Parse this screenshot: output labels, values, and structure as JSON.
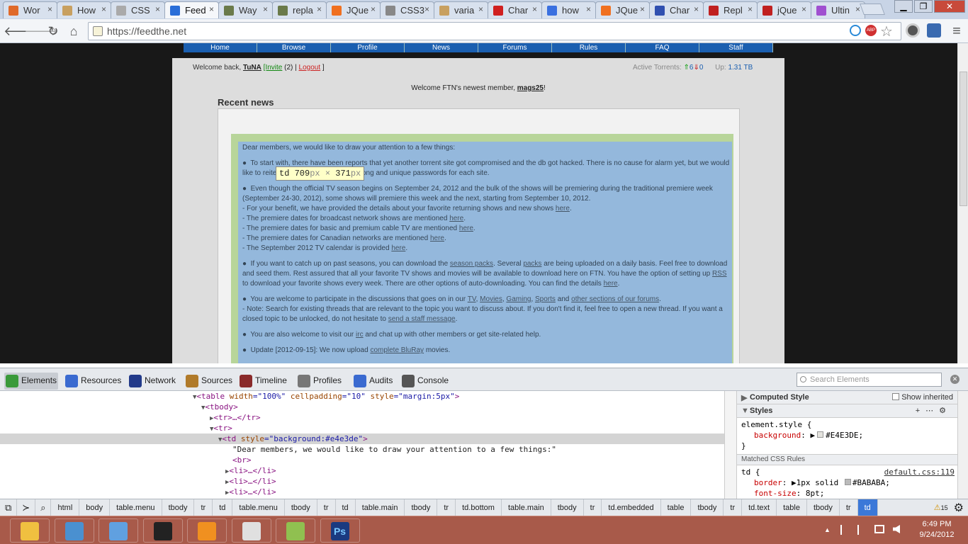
{
  "tabs": [
    {
      "label": "Wor",
      "color": "#e06a2a",
      "icon": "swirl-icon"
    },
    {
      "label": "How",
      "color": "#c8a060",
      "icon": "page-icon"
    },
    {
      "label": "CSS",
      "color": "#aaaaaa",
      "icon": "doc-icon"
    },
    {
      "label": "Feed",
      "color": "#2a6ed8",
      "icon": "feedthe-icon"
    },
    {
      "label": "Way",
      "color": "#6a7a4a",
      "icon": "zine-icon"
    },
    {
      "label": "repla",
      "color": "#6a7a4a",
      "icon": "zine-icon"
    },
    {
      "label": "JQue",
      "color": "#f07020",
      "icon": "blogger-icon"
    },
    {
      "label": "CSS3",
      "color": "#888888",
      "icon": "css3-icon"
    },
    {
      "label": "varia",
      "color": "#c8a060",
      "icon": "page-icon"
    },
    {
      "label": "Char",
      "color": "#d02020",
      "icon": "char-icon"
    },
    {
      "label": "how",
      "color": "#3a70e0",
      "icon": "google-icon"
    },
    {
      "label": "JQue",
      "color": "#f07020",
      "icon": "blogger-icon"
    },
    {
      "label": "Char",
      "color": "#3050b0",
      "icon": "m-icon"
    },
    {
      "label": "Repl",
      "color": "#c02020",
      "icon": "opera-icon"
    },
    {
      "label": "jQue",
      "color": "#c02020",
      "icon": "opera-icon"
    },
    {
      "label": "Ultin",
      "color": "#a050d0",
      "icon": "rainbow-icon"
    }
  ],
  "window": {
    "minimize": "▁",
    "restore": "❐",
    "close": "✕"
  },
  "toolbar": {
    "back": "🡐",
    "forward": "🡒",
    "reload": "↻",
    "home": "⌂",
    "url": "https://feedthe.net",
    "abp": "ABP",
    "star": "☆",
    "menu": "≡"
  },
  "site": {
    "nav": [
      "Home",
      "Browse",
      "Profile",
      "News",
      "Forums",
      "Rules",
      "FAQ",
      "Staff"
    ],
    "welcome_prefix": "Welcome back,",
    "username": "TuNA",
    "invite": "[Invite",
    "invite_count": "(2)",
    "sep": "|",
    "logout": "Logout",
    "close_bracket": "]",
    "active_label": "Active Torrents:",
    "seed_arrow": "⇑",
    "seed_count": "6",
    "leech_arrow": "⇓",
    "leech_count": "0",
    "up_label": "Up:",
    "up_value": "1.31 TB",
    "newest_prefix": "Welcome FTN's newest member,",
    "newest_member": "mags25",
    "newest_suffix": "!",
    "recent_news": "Recent news",
    "tooltip_tag": "td",
    "tooltip_w": "709",
    "tooltip_h": "371",
    "tooltip_px1": "px",
    "tooltip_x": " × ",
    "tooltip_px2": "px",
    "news_intro": "Dear members, we would like to draw your attention to a few things:",
    "p1": "To start with, there have been reports that yet another torrent site got compromised and the db got hacked. There is no cause for alarm yet, but we would like to reiterate that you should use strong and unique passwords for each site.",
    "p2a": "Even though the official TV season begins on September 24, 2012 and the bulk of the shows will be premiering during the traditional premiere week (September 24-30, 2012), some shows will premiere this week and the next, starting from September 10, 2012.",
    "p2b": "- For your benefit, we have provided the details about your favorite returning shows and new shows",
    "p2c": "- The premiere dates for broadcast network shows are mentioned",
    "p2d": "- The premiere dates for basic and premium cable TV are mentioned",
    "p2e": "- The premiere dates for Canadian networks are mentioned",
    "p2f": "- The September 2012 TV calendar is provided",
    "here": "here",
    "dot": ".",
    "p3a": "If you want to catch up on past seasons, you can download the",
    "season_packs": "season packs",
    "p3b": ". Several",
    "packs": "packs",
    "p3c": "are being uploaded on a daily basis. Feel free to download and seed them. Rest assured that all your favorite TV shows and movies will be available to download here on FTN. You have the option of setting up",
    "rss": "RSS",
    "p3d": "to download your favorite shows every week. There are other options of auto-downloading. You can find the details",
    "p4a": "You are welcome to participate in the discussions that goes on in our",
    "tv": "TV",
    "movies": "Movies",
    "gaming": "Gaming",
    "sports": "Sports",
    "and_text": "and",
    "other_sections": "other sections of our forums",
    "comma": ",",
    "p4b": "- Note: Search for existing threads that are relevant to the topic you want to discuss about. If you don't find it, feel free to open a new thread. If you want a closed topic to be unlocked, do not hesitate to",
    "staff_message": "send a staff message",
    "p5a": "You are also welcome to visit our",
    "irc": "irc",
    "p5b": "and chat up with other members or get site-related help.",
    "p6a": "Update [2012-09-15]: We now upload",
    "bluray": "complete BluRay",
    "p6b": "movies."
  },
  "devtools": {
    "tabs": [
      "Elements",
      "Resources",
      "Network",
      "Sources",
      "Timeline",
      "Profiles",
      "Audits",
      "Console"
    ],
    "search_placeholder": "Search Elements",
    "close": "✕",
    "dom": [
      {
        "tri": "▼",
        "open": "<table",
        "attrs": [
          [
            " width",
            "=\"100%\""
          ],
          [
            " cellpadding",
            "=\"10\""
          ],
          [
            " style",
            "=\"margin:5px\""
          ]
        ],
        "close": ">"
      },
      {
        "tri": "▼",
        "open": "<tbody",
        "attrs": [],
        "close": ">"
      },
      {
        "tri": "▶",
        "open": "<tr",
        "attrs": [],
        "close": ">…</tr>"
      },
      {
        "tri": "▼",
        "open": "<tr",
        "attrs": [],
        "close": ">"
      },
      {
        "tri": "▼",
        "open": "<td",
        "attrs": [
          [
            " style",
            "=\"background:#e4e3de\""
          ]
        ],
        "close": ">"
      },
      {
        "tri": "",
        "text": "\"Dear members, we would like to draw your attention to a few things:\""
      },
      {
        "tri": "",
        "open": "<br",
        "attrs": [],
        "close": ">"
      },
      {
        "tri": "▶",
        "open": "<li",
        "attrs": [],
        "close": ">…</li>"
      },
      {
        "tri": "▶",
        "open": "<li",
        "attrs": [],
        "close": ">…</li>"
      },
      {
        "tri": "▶",
        "open": "<li",
        "attrs": [],
        "close": ">…</li>"
      },
      {
        "tri": "▶",
        "open": "<li",
        "attrs": [],
        "close": ">…</li>"
      }
    ],
    "computed": "Computed Style",
    "show_inherited": "Show inherited",
    "styles": "Styles",
    "style_tools": [
      "+",
      "⋯",
      "⚙"
    ],
    "element_style": "element.style {",
    "bg_prop": "background",
    "bg_val": "#E4E3DE;",
    "close_brace": "}",
    "matched": "Matched CSS Rules",
    "td_sel": "td {",
    "source": "default.css:119",
    "border_prop": "border",
    "border_val1": "1px solid",
    "border_val2": "#BABABA;",
    "font_prop": "font-size",
    "font_val": "8pt;",
    "crumbs": [
      "html",
      "body",
      "table.menu",
      "tbody",
      "tr",
      "td",
      "table.menu",
      "tbody",
      "tr",
      "td",
      "table.main",
      "tbody",
      "tr",
      "td.bottom",
      "table.main",
      "tbody",
      "tr",
      "td.embedded",
      "table",
      "tbody",
      "tr",
      "td.text",
      "table",
      "tbody",
      "tr",
      "td"
    ],
    "warnings": "15",
    "warn_icon": "⚠",
    "settings_icon": "⚙"
  },
  "taskbar": {
    "apps": [
      {
        "name": "explorer",
        "color": "#f0c040"
      },
      {
        "name": "network",
        "color": "#4a90d0"
      },
      {
        "name": "messenger",
        "color": "#60a0e0"
      },
      {
        "name": "media",
        "color": "#222222"
      },
      {
        "name": "itunes",
        "color": "#f09020"
      },
      {
        "name": "notepad",
        "color": "#e0e0e0"
      },
      {
        "name": "notepadpp",
        "color": "#90c050"
      },
      {
        "name": "photoshop",
        "color": "#1a3a80"
      }
    ],
    "ps_label": "Ps",
    "tray_up": "▲",
    "time": "6:49 PM",
    "date": "9/24/2012"
  }
}
